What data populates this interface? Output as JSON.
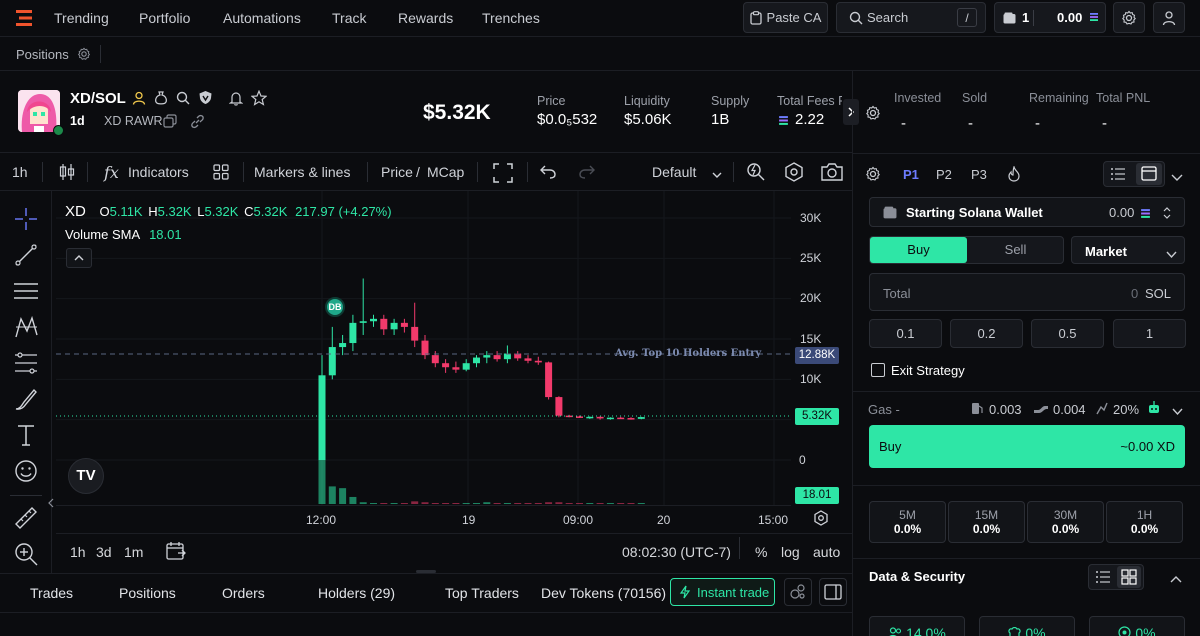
{
  "nav": {
    "items": [
      "Trending",
      "Portfolio",
      "Automations",
      "Track",
      "Rewards",
      "Trenches"
    ],
    "paste_ca": "Paste CA",
    "search_placeholder": "Search",
    "search_shortcut": "/",
    "wallet_count": "1",
    "wallet_balance": "0.00"
  },
  "positions_bar": {
    "label": "Positions"
  },
  "token": {
    "pair": "XD/SOL",
    "age": "1d",
    "name": "XD RAWR",
    "market_cap": "$5.32K",
    "stats": [
      {
        "label": "Price",
        "value": "$0.0₅532"
      },
      {
        "label": "Liquidity",
        "value": "$5.06K"
      },
      {
        "label": "Supply",
        "value": "1B"
      },
      {
        "label": "Total Fees P",
        "value": "2.22"
      }
    ]
  },
  "position_stats": [
    {
      "label": "Invested",
      "value": "-"
    },
    {
      "label": "Sold",
      "value": "-"
    },
    {
      "label": "Remaining",
      "value": "-"
    },
    {
      "label": "Total PNL",
      "value": "-"
    }
  ],
  "chart_toolbar": {
    "interval": "1h",
    "indicators": "Indicators",
    "markers": "Markers & lines",
    "price": "Price",
    "slash": "/",
    "mcap": "MCap",
    "layout": "Default"
  },
  "chart_legend": {
    "symbol": "XD",
    "o_label": "O",
    "o": "5.11K",
    "h_label": "H",
    "h": "5.32K",
    "l_label": "L",
    "l": "5.32K",
    "c_label": "C",
    "c": "5.32K",
    "change": "217.97 (+4.27%)",
    "volume_label": "Volume SMA",
    "volume_value": "18.01"
  },
  "chart_data": {
    "type": "candlestick",
    "y_ticks": [
      "30K",
      "25K",
      "20K",
      "15K",
      "10K",
      "0"
    ],
    "x_ticks": [
      "12:00",
      "19",
      "09:00",
      "20",
      "15:00"
    ],
    "avg_line_label": "Avg. Top 10 Holders Entry",
    "avg_line_value": "12.88K",
    "last_price_tag": "5.32K",
    "volume_tag": "18.01",
    "dev_marker": "DB",
    "candles": [
      {
        "o": 0,
        "h": 13000,
        "l": 0,
        "c": 10500
      },
      {
        "o": 10500,
        "h": 16500,
        "l": 10000,
        "c": 14000
      },
      {
        "o": 14000,
        "h": 15500,
        "l": 13000,
        "c": 14500
      },
      {
        "o": 14500,
        "h": 18000,
        "l": 13500,
        "c": 17000
      },
      {
        "o": 17000,
        "h": 22500,
        "l": 15500,
        "c": 17200
      },
      {
        "o": 17200,
        "h": 18000,
        "l": 16500,
        "c": 17500
      },
      {
        "o": 17500,
        "h": 18000,
        "l": 15500,
        "c": 16200
      },
      {
        "o": 16200,
        "h": 17500,
        "l": 15500,
        "c": 17000
      },
      {
        "o": 17000,
        "h": 17500,
        "l": 15800,
        "c": 16500
      },
      {
        "o": 16500,
        "h": 19500,
        "l": 14000,
        "c": 14800
      },
      {
        "o": 14800,
        "h": 15500,
        "l": 12500,
        "c": 13000
      },
      {
        "o": 13000,
        "h": 13500,
        "l": 11500,
        "c": 12000
      },
      {
        "o": 12000,
        "h": 12500,
        "l": 10800,
        "c": 11500
      },
      {
        "o": 11500,
        "h": 12200,
        "l": 10800,
        "c": 11200
      },
      {
        "o": 11200,
        "h": 12500,
        "l": 11000,
        "c": 12000
      },
      {
        "o": 12000,
        "h": 13000,
        "l": 11500,
        "c": 12700
      },
      {
        "o": 12700,
        "h": 13500,
        "l": 12000,
        "c": 13000
      },
      {
        "o": 13000,
        "h": 13500,
        "l": 12200,
        "c": 12500
      },
      {
        "o": 12500,
        "h": 14200,
        "l": 12000,
        "c": 13200
      },
      {
        "o": 13200,
        "h": 13500,
        "l": 12300,
        "c": 12600
      },
      {
        "o": 12600,
        "h": 13000,
        "l": 12000,
        "c": 12300
      },
      {
        "o": 12300,
        "h": 12800,
        "l": 11800,
        "c": 12100
      },
      {
        "o": 12100,
        "h": 12200,
        "l": 7500,
        "c": 7800
      },
      {
        "o": 7800,
        "h": 7900,
        "l": 5300,
        "c": 5500
      },
      {
        "o": 5500,
        "h": 5600,
        "l": 5300,
        "c": 5400
      },
      {
        "o": 5400,
        "h": 5500,
        "l": 5200,
        "c": 5300
      },
      {
        "o": 5300,
        "h": 5400,
        "l": 5100,
        "c": 5350
      },
      {
        "o": 5350,
        "h": 5400,
        "l": 5000,
        "c": 5150
      },
      {
        "o": 5150,
        "h": 5300,
        "l": 5000,
        "c": 5250
      },
      {
        "o": 5250,
        "h": 5350,
        "l": 5100,
        "c": 5200
      },
      {
        "o": 5200,
        "h": 5300,
        "l": 5000,
        "c": 5100
      },
      {
        "o": 5100,
        "h": 5350,
        "l": 5050,
        "c": 5320
      }
    ],
    "volumes": [
      100,
      20,
      18,
      8,
      2,
      1,
      1,
      1,
      1,
      3,
      2,
      1,
      1,
      1,
      1,
      1,
      2,
      1,
      1,
      1,
      1,
      1,
      2,
      2,
      1,
      1,
      1,
      1,
      1,
      1,
      1,
      1
    ]
  },
  "chart_footer": {
    "ranges": [
      "1h",
      "3d",
      "1m"
    ],
    "time": "08:02:30 (UTC-7)",
    "pct": "%",
    "log": "log",
    "auto": "auto"
  },
  "bottom_tabs": [
    "Trades",
    "Positions",
    "Orders",
    "Holders (29)",
    "Top Traders",
    "Dev Tokens (70156)"
  ],
  "instant_trade": "Instant trade",
  "trade_panel": {
    "presets": [
      "P1",
      "P2",
      "P3"
    ],
    "wallet_label": "Starting Solana Wallet",
    "wallet_value": "0.00",
    "buy_tab": "Buy",
    "sell_tab": "Sell",
    "order_type": "Market",
    "total_label": "Total",
    "total_value": "0",
    "total_unit": "SOL",
    "quick_amounts": [
      "0.1",
      "0.2",
      "0.5",
      "1"
    ],
    "exit_strategy": "Exit Strategy",
    "gas_label": "Gas -",
    "gas_fee": "0.003",
    "priority_fee": "0.004",
    "slippage": "20%",
    "buy_button": "Buy",
    "buy_estimate": "~0.00 XD",
    "timeframes": [
      {
        "label": "5M",
        "value": "0.0%"
      },
      {
        "label": "15M",
        "value": "0.0%"
      },
      {
        "label": "30M",
        "value": "0.0%"
      },
      {
        "label": "1H",
        "value": "0.0%"
      }
    ],
    "data_security": "Data & Security",
    "security_stats": [
      "14.0%",
      "0%",
      "0%"
    ]
  },
  "colors": {
    "up": "#2ee6a6",
    "down": "#f23a6b",
    "accent": "#6d7cff",
    "brand": "#f0542d"
  }
}
